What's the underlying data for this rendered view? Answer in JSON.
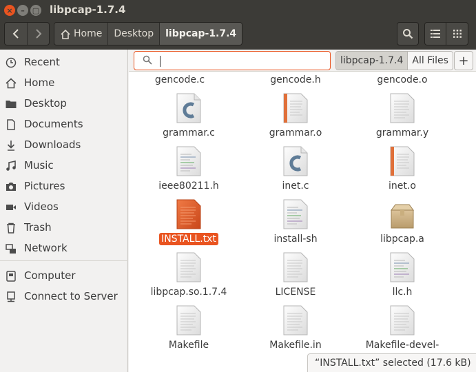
{
  "window": {
    "title": "libpcap-1.7.4",
    "close_glyph": "×",
    "minimize_glyph": "–",
    "maximize_glyph": "▢"
  },
  "nav": {
    "back_icon": "chevron-left",
    "forward_icon": "chevron-right"
  },
  "breadcrumb": {
    "home": "Home",
    "desktop": "Desktop",
    "current": "libpcap-1.7.4"
  },
  "toolbar": {
    "search_icon": "search",
    "list_icon": "list-view",
    "grid_icon": "grid-view"
  },
  "sidebar": {
    "items": [
      {
        "label": "Recent",
        "icon": "clock"
      },
      {
        "label": "Home",
        "icon": "home"
      },
      {
        "label": "Desktop",
        "icon": "folder"
      },
      {
        "label": "Documents",
        "icon": "document"
      },
      {
        "label": "Downloads",
        "icon": "download"
      },
      {
        "label": "Music",
        "icon": "music"
      },
      {
        "label": "Pictures",
        "icon": "camera"
      },
      {
        "label": "Videos",
        "icon": "video"
      },
      {
        "label": "Trash",
        "icon": "trash"
      },
      {
        "label": "Network",
        "icon": "network"
      },
      {
        "label": "Computer",
        "icon": "computer"
      },
      {
        "label": "Connect to Server",
        "icon": "server"
      }
    ]
  },
  "search": {
    "value": "",
    "scope_current": "libpcap-1.7.4",
    "scope_all": "All Files",
    "add_label": "+"
  },
  "files": {
    "r0": [
      "gencode.c",
      "gencode.h",
      "gencode.o"
    ],
    "r1": [
      "grammar.c",
      "grammar.o",
      "grammar.y"
    ],
    "r2": [
      "ieee80211.h",
      "inet.c",
      "inet.o"
    ],
    "r3": [
      "INSTALL.txt",
      "install-sh",
      "libpcap.a"
    ],
    "r4": [
      "libpcap.so.1.7.4",
      "LICENSE",
      "llc.h"
    ],
    "r5": [
      "Makefile",
      "Makefile.in",
      "Makefile-devel-"
    ]
  },
  "status": {
    "text": "“INSTALL.txt” selected  (17.6 kB)"
  },
  "colors": {
    "accent": "#e95420",
    "header": "#3c3b37"
  }
}
